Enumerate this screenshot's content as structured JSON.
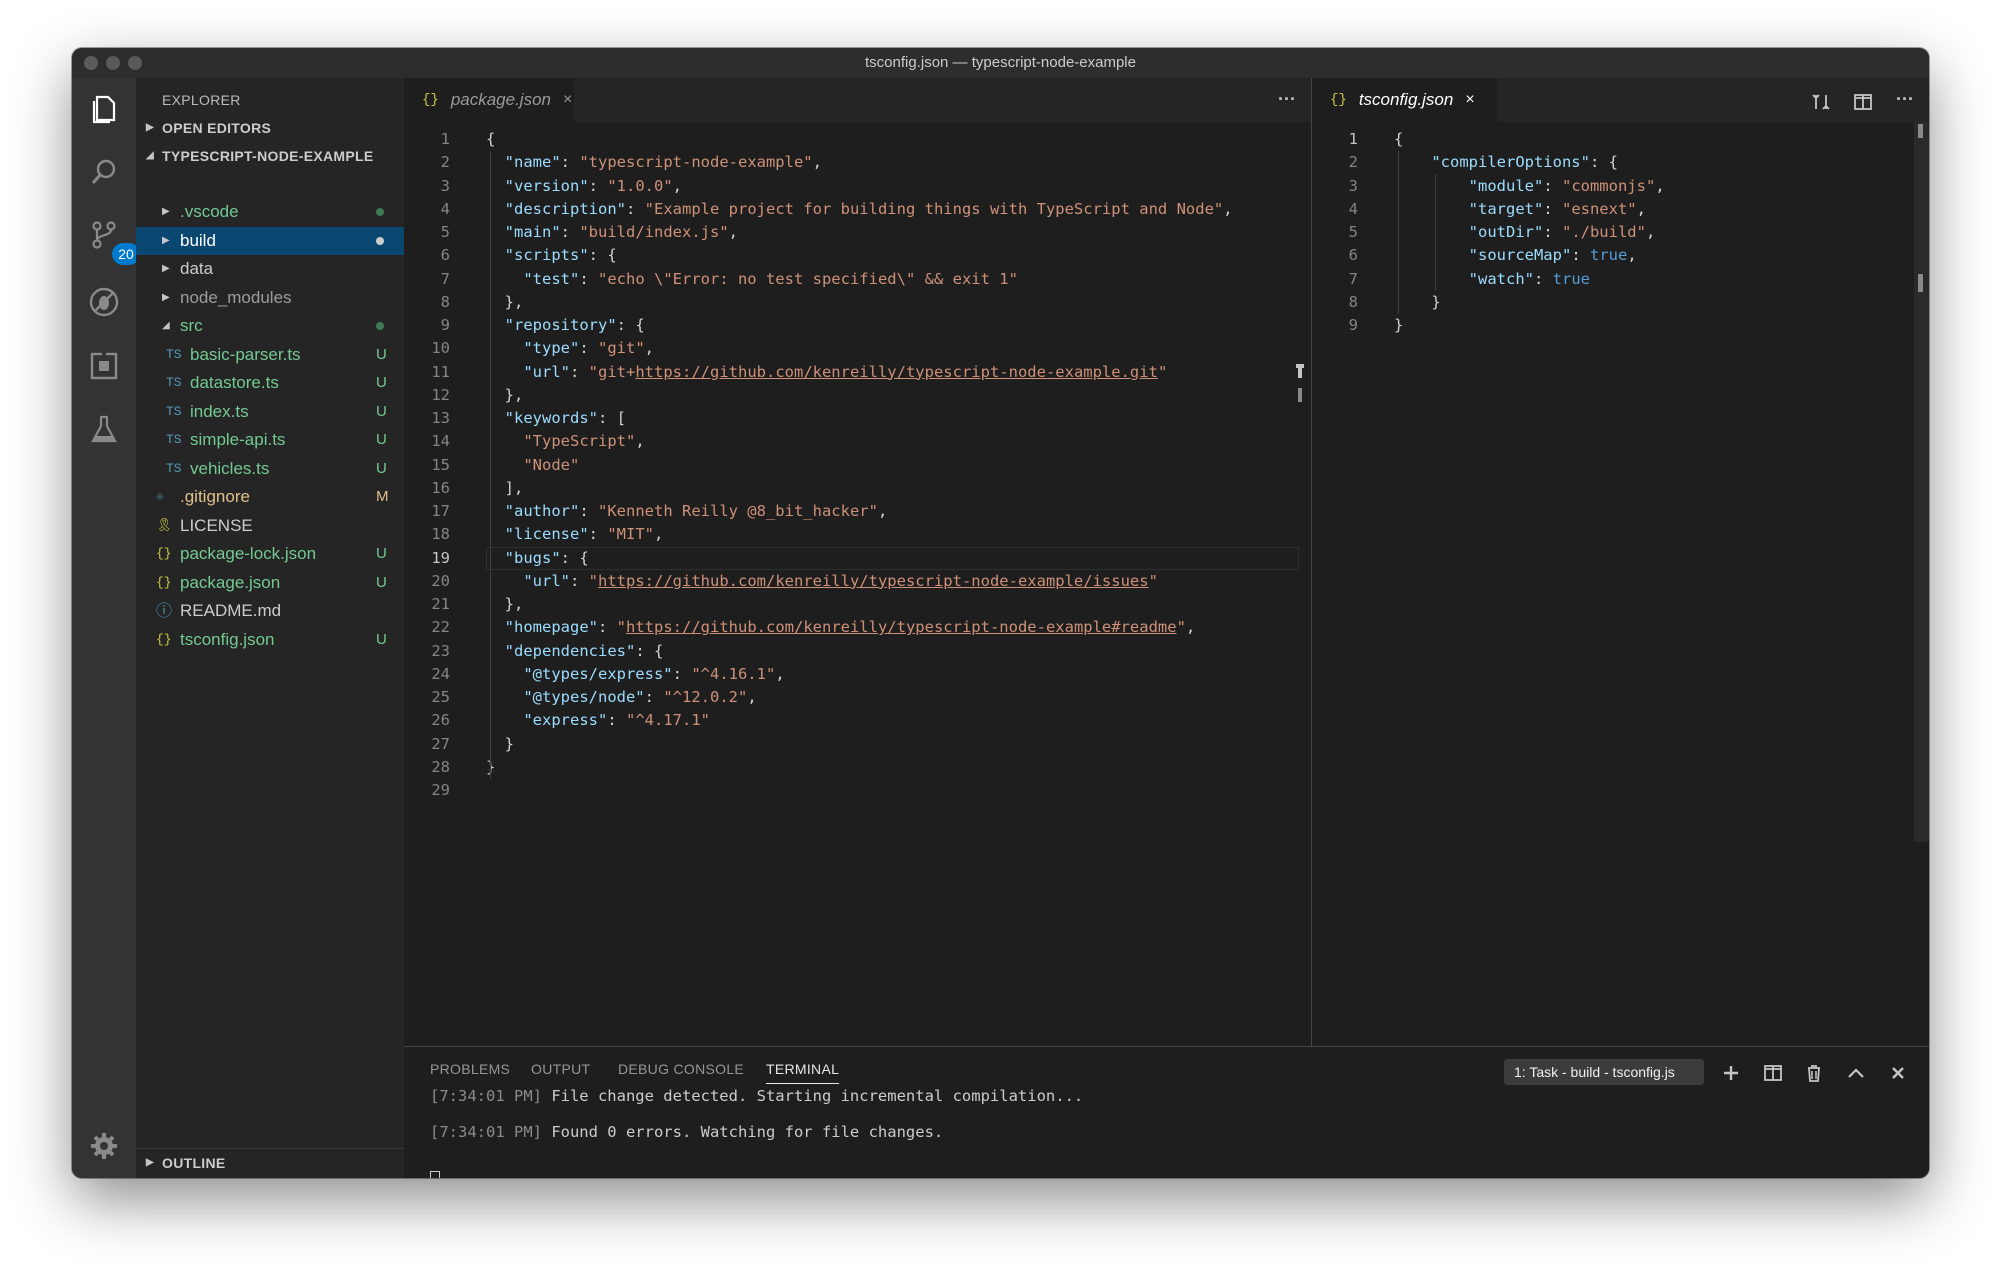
{
  "window": {
    "title": "tsconfig.json — typescript-node-example"
  },
  "activity_bar": {
    "items": [
      "explorer-icon",
      "search-icon",
      "source-control-icon",
      "debug-icon",
      "extensions-icon",
      "test-icon",
      "settings-gear-icon"
    ],
    "scm_badge": "20"
  },
  "sidebar": {
    "title": "EXPLORER",
    "open_editors": "OPEN EDITORS",
    "project": "TYPESCRIPT-NODE-EXAMPLE",
    "outline": "OUTLINE",
    "colors": {
      "untracked": "#73c991",
      "modified": "#e2c08d",
      "selected": "#094771"
    },
    "files": [
      {
        "name": ".vscode",
        "kind": "folder",
        "status": ""
      },
      {
        "name": "build",
        "kind": "folder",
        "status": ""
      },
      {
        "name": "data",
        "kind": "folder",
        "status": ""
      },
      {
        "name": "node_modules",
        "kind": "folder",
        "status": ""
      },
      {
        "name": "src",
        "kind": "folder",
        "status": ""
      },
      {
        "name": "basic-parser.ts",
        "icon": "TS",
        "status": "U"
      },
      {
        "name": "datastore.ts",
        "icon": "TS",
        "status": "U"
      },
      {
        "name": "index.ts",
        "icon": "TS",
        "status": "U"
      },
      {
        "name": "simple-api.ts",
        "icon": "TS",
        "status": "U"
      },
      {
        "name": "vehicles.ts",
        "icon": "TS",
        "status": "U"
      },
      {
        "name": ".gitignore",
        "icon": "git-icon",
        "status": "M"
      },
      {
        "name": "LICENSE",
        "icon": "license-icon",
        "status": ""
      },
      {
        "name": "package-lock.json",
        "icon": "{}",
        "status": "U"
      },
      {
        "name": "package.json",
        "icon": "{}",
        "status": "U"
      },
      {
        "name": "README.md",
        "icon": "info-icon",
        "status": ""
      },
      {
        "name": "tsconfig.json",
        "icon": "{}",
        "status": "U"
      }
    ]
  },
  "editor_left": {
    "tab_icon": "{}",
    "tab_label": "package.json",
    "tab_close": "×",
    "more": "···",
    "active_line": 19,
    "line_numbers": [
      "1",
      "2",
      "3",
      "4",
      "5",
      "6",
      "7",
      "8",
      "9",
      "10",
      "11",
      "12",
      "13",
      "14",
      "15",
      "16",
      "17",
      "18",
      "19",
      "20",
      "21",
      "22",
      "23",
      "24",
      "25",
      "26",
      "27",
      "28",
      "29"
    ],
    "lines": [
      [
        [
          "p",
          "{"
        ]
      ],
      [
        [
          "p",
          "  "
        ],
        [
          "k",
          "\"name\""
        ],
        [
          "p",
          ": "
        ],
        [
          "s",
          "\"typescript-node-example\""
        ],
        [
          "p",
          ","
        ]
      ],
      [
        [
          "p",
          "  "
        ],
        [
          "k",
          "\"version\""
        ],
        [
          "p",
          ": "
        ],
        [
          "s",
          "\"1.0.0\""
        ],
        [
          "p",
          ","
        ]
      ],
      [
        [
          "p",
          "  "
        ],
        [
          "k",
          "\"description\""
        ],
        [
          "p",
          ": "
        ],
        [
          "s",
          "\"Example project for building things with TypeScript and Node\""
        ],
        [
          "p",
          ","
        ]
      ],
      [
        [
          "p",
          "  "
        ],
        [
          "k",
          "\"main\""
        ],
        [
          "p",
          ": "
        ],
        [
          "s",
          "\"build/index.js\""
        ],
        [
          "p",
          ","
        ]
      ],
      [
        [
          "p",
          "  "
        ],
        [
          "k",
          "\"scripts\""
        ],
        [
          "p",
          ": {"
        ]
      ],
      [
        [
          "p",
          "    "
        ],
        [
          "k",
          "\"test\""
        ],
        [
          "p",
          ": "
        ],
        [
          "s",
          "\"echo \\\"Error: no test specified\\\" && exit 1\""
        ]
      ],
      [
        [
          "p",
          "  },"
        ]
      ],
      [
        [
          "p",
          "  "
        ],
        [
          "k",
          "\"repository\""
        ],
        [
          "p",
          ": {"
        ]
      ],
      [
        [
          "p",
          "    "
        ],
        [
          "k",
          "\"type\""
        ],
        [
          "p",
          ": "
        ],
        [
          "s",
          "\"git\""
        ],
        [
          "p",
          ","
        ]
      ],
      [
        [
          "p",
          "    "
        ],
        [
          "k",
          "\"url\""
        ],
        [
          "p",
          ": "
        ],
        [
          "s",
          "\"git+"
        ],
        [
          "u",
          "https://github.com/kenreilly/typescript-node-example.git"
        ],
        [
          "s",
          "\""
        ]
      ],
      [
        [
          "p",
          "  },"
        ]
      ],
      [
        [
          "p",
          "  "
        ],
        [
          "k",
          "\"keywords\""
        ],
        [
          "p",
          ": ["
        ]
      ],
      [
        [
          "p",
          "    "
        ],
        [
          "s",
          "\"TypeScript\""
        ],
        [
          "p",
          ","
        ]
      ],
      [
        [
          "p",
          "    "
        ],
        [
          "s",
          "\"Node\""
        ]
      ],
      [
        [
          "p",
          "  ],"
        ]
      ],
      [
        [
          "p",
          "  "
        ],
        [
          "k",
          "\"author\""
        ],
        [
          "p",
          ": "
        ],
        [
          "s",
          "\"Kenneth Reilly @8_bit_hacker\""
        ],
        [
          "p",
          ","
        ]
      ],
      [
        [
          "p",
          "  "
        ],
        [
          "k",
          "\"license\""
        ],
        [
          "p",
          ": "
        ],
        [
          "s",
          "\"MIT\""
        ],
        [
          "p",
          ","
        ]
      ],
      [
        [
          "p",
          "  "
        ],
        [
          "k",
          "\"bugs\""
        ],
        [
          "p",
          ": {"
        ]
      ],
      [
        [
          "p",
          "    "
        ],
        [
          "k",
          "\"url\""
        ],
        [
          "p",
          ": "
        ],
        [
          "s",
          "\""
        ],
        [
          "u",
          "https://github.com/kenreilly/typescript-node-example/issues"
        ],
        [
          "s",
          "\""
        ]
      ],
      [
        [
          "p",
          "  },"
        ]
      ],
      [
        [
          "p",
          "  "
        ],
        [
          "k",
          "\"homepage\""
        ],
        [
          "p",
          ": "
        ],
        [
          "s",
          "\""
        ],
        [
          "u",
          "https://github.com/kenreilly/typescript-node-example#readme"
        ],
        [
          "s",
          "\""
        ],
        [
          "p",
          ","
        ]
      ],
      [
        [
          "p",
          "  "
        ],
        [
          "k",
          "\"dependencies\""
        ],
        [
          "p",
          ": {"
        ]
      ],
      [
        [
          "p",
          "    "
        ],
        [
          "k",
          "\"@types/express\""
        ],
        [
          "p",
          ": "
        ],
        [
          "s",
          "\"^4.16.1\""
        ],
        [
          "p",
          ","
        ]
      ],
      [
        [
          "p",
          "    "
        ],
        [
          "k",
          "\"@types/node\""
        ],
        [
          "p",
          ": "
        ],
        [
          "s",
          "\"^12.0.2\""
        ],
        [
          "p",
          ","
        ]
      ],
      [
        [
          "p",
          "    "
        ],
        [
          "k",
          "\"express\""
        ],
        [
          "p",
          ": "
        ],
        [
          "s",
          "\"^4.17.1\""
        ]
      ],
      [
        [
          "p",
          "  }"
        ]
      ],
      [
        [
          "p",
          "}"
        ]
      ],
      [
        [
          "p",
          ""
        ]
      ]
    ]
  },
  "editor_right": {
    "tab_icon": "{}",
    "tab_label": "tsconfig.json",
    "tab_close": "×",
    "active_line": 1,
    "line_numbers": [
      "1",
      "2",
      "3",
      "4",
      "5",
      "6",
      "7",
      "8",
      "9"
    ],
    "lines": [
      [
        [
          "p",
          "{"
        ]
      ],
      [
        [
          "p",
          "    "
        ],
        [
          "k",
          "\"compilerOptions\""
        ],
        [
          "p",
          ": {"
        ]
      ],
      [
        [
          "p",
          "        "
        ],
        [
          "k",
          "\"module\""
        ],
        [
          "p",
          ": "
        ],
        [
          "s",
          "\"commonjs\""
        ],
        [
          "p",
          ","
        ]
      ],
      [
        [
          "p",
          "        "
        ],
        [
          "k",
          "\"target\""
        ],
        [
          "p",
          ": "
        ],
        [
          "s",
          "\"esnext\""
        ],
        [
          "p",
          ","
        ]
      ],
      [
        [
          "p",
          "        "
        ],
        [
          "k",
          "\"outDir\""
        ],
        [
          "p",
          ": "
        ],
        [
          "s",
          "\"./build\""
        ],
        [
          "p",
          ","
        ]
      ],
      [
        [
          "p",
          "        "
        ],
        [
          "k",
          "\"sourceMap\""
        ],
        [
          "p",
          ": "
        ],
        [
          "b",
          "true"
        ],
        [
          "p",
          ","
        ]
      ],
      [
        [
          "p",
          "        "
        ],
        [
          "k",
          "\"watch\""
        ],
        [
          "p",
          ": "
        ],
        [
          "b",
          "true"
        ]
      ],
      [
        [
          "p",
          "    }"
        ]
      ],
      [
        [
          "p",
          "}"
        ]
      ]
    ]
  },
  "panel": {
    "tabs": [
      "PROBLEMS",
      "OUTPUT",
      "DEBUG CONSOLE",
      "TERMINAL"
    ],
    "active_tab": "TERMINAL",
    "task_select": "1: Task - build - tsconfig.js",
    "terminal": [
      {
        "time": "[7:34:01 PM]",
        "text": " File change detected. Starting incremental compilation..."
      },
      {
        "time": "[7:34:01 PM]",
        "text": " Found 0 errors. Watching for file changes."
      }
    ]
  }
}
